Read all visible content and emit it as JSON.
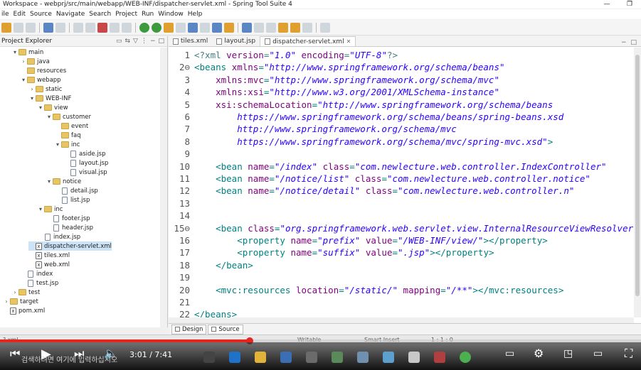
{
  "window": {
    "title": "Workspace - webprj/src/main/webapp/WEB-INF/dispatcher-servlet.xml - Spring Tool Suite 4",
    "controls": [
      "—",
      "❐"
    ]
  },
  "menu": [
    "ile",
    "Edit",
    "Source",
    "Navigate",
    "Search",
    "Project",
    "Run",
    "Window",
    "Help"
  ],
  "explorer": {
    "title": "Project Explorer",
    "tree": [
      {
        "label": "main",
        "indent": 1,
        "icon": "folder",
        "arrow": "▾"
      },
      {
        "label": "java",
        "indent": 2,
        "icon": "folder",
        "arrow": "›"
      },
      {
        "label": "resources",
        "indent": 2,
        "icon": "folder",
        "arrow": ""
      },
      {
        "label": "webapp",
        "indent": 2,
        "icon": "folder",
        "arrow": "▾"
      },
      {
        "label": "static",
        "indent": 3,
        "icon": "folder",
        "arrow": "›"
      },
      {
        "label": "WEB-INF",
        "indent": 3,
        "icon": "folder",
        "arrow": "▾"
      },
      {
        "label": "view",
        "indent": 4,
        "icon": "folder",
        "arrow": "▾"
      },
      {
        "label": "customer",
        "indent": 5,
        "icon": "folder",
        "arrow": "▾"
      },
      {
        "label": "event",
        "indent": 6,
        "icon": "folder",
        "arrow": ""
      },
      {
        "label": "faq",
        "indent": 6,
        "icon": "folder",
        "arrow": ""
      },
      {
        "label": "inc",
        "indent": 6,
        "icon": "folder",
        "arrow": "▾"
      },
      {
        "label": "aside.jsp",
        "indent": 7,
        "icon": "file",
        "arrow": ""
      },
      {
        "label": "layout.jsp",
        "indent": 7,
        "icon": "file",
        "arrow": ""
      },
      {
        "label": "visual.jsp",
        "indent": 7,
        "icon": "file",
        "arrow": ""
      },
      {
        "label": "notice",
        "indent": 5,
        "icon": "folder",
        "arrow": "▾"
      },
      {
        "label": "detail.jsp",
        "indent": 6,
        "icon": "file",
        "arrow": ""
      },
      {
        "label": "list.jsp",
        "indent": 6,
        "icon": "file",
        "arrow": ""
      },
      {
        "label": "inc",
        "indent": 4,
        "icon": "folder",
        "arrow": "▾"
      },
      {
        "label": "footer.jsp",
        "indent": 5,
        "icon": "file",
        "arrow": ""
      },
      {
        "label": "header.jsp",
        "indent": 5,
        "icon": "file",
        "arrow": ""
      },
      {
        "label": "index.jsp",
        "indent": 4,
        "icon": "file",
        "arrow": ""
      },
      {
        "label": "dispatcher-servlet.xml",
        "indent": 3,
        "icon": "xml",
        "arrow": "",
        "selected": true
      },
      {
        "label": "tiles.xml",
        "indent": 3,
        "icon": "xml",
        "arrow": ""
      },
      {
        "label": "web.xml",
        "indent": 3,
        "icon": "xml",
        "arrow": ""
      },
      {
        "label": "index",
        "indent": 2,
        "icon": "file",
        "arrow": ""
      },
      {
        "label": "test.jsp",
        "indent": 2,
        "icon": "file",
        "arrow": ""
      },
      {
        "label": "test",
        "indent": 1,
        "icon": "folder",
        "arrow": "›"
      },
      {
        "label": "target",
        "indent": 0,
        "icon": "folder",
        "arrow": "›"
      },
      {
        "label": "pom.xml",
        "indent": 0,
        "icon": "xml",
        "arrow": ""
      }
    ]
  },
  "editor": {
    "tabs": [
      {
        "label": "tiles.xml",
        "active": false
      },
      {
        "label": "layout.jsp",
        "active": false
      },
      {
        "label": "dispatcher-servlet.xml",
        "active": true
      }
    ],
    "lines": [
      {
        "n": "1",
        "tokens": [
          [
            "pi",
            "<?xml "
          ],
          [
            "a",
            "version"
          ],
          [
            "pi",
            "="
          ],
          [
            "v",
            "\"1.0\""
          ],
          [
            "pi",
            " "
          ],
          [
            "a",
            "encoding"
          ],
          [
            "pi",
            "="
          ],
          [
            "v",
            "\"UTF-8\""
          ],
          [
            "pi",
            "?>"
          ]
        ]
      },
      {
        "n": "2⊖",
        "tokens": [
          [
            "p",
            "<beans "
          ],
          [
            "a",
            "xmlns"
          ],
          [
            "p",
            "="
          ],
          [
            "v",
            "\"http://www.springframework.org/schema/beans\""
          ]
        ]
      },
      {
        "n": "3",
        "tokens": [
          [
            "p",
            "    "
          ],
          [
            "a",
            "xmlns:mvc"
          ],
          [
            "p",
            "="
          ],
          [
            "v",
            "\"http://www.springframework.org/schema/mvc\""
          ]
        ]
      },
      {
        "n": "4",
        "tokens": [
          [
            "p",
            "    "
          ],
          [
            "a",
            "xmlns:xsi"
          ],
          [
            "p",
            "="
          ],
          [
            "v",
            "\"http://www.w3.org/2001/XMLSchema-instance\""
          ]
        ]
      },
      {
        "n": "5",
        "tokens": [
          [
            "p",
            "    "
          ],
          [
            "a",
            "xsi:schemaLocation"
          ],
          [
            "p",
            "="
          ],
          [
            "v",
            "\"http://www.springframework.org/schema/beans"
          ]
        ]
      },
      {
        "n": "6",
        "tokens": [
          [
            "v",
            "        https://www.springframework.org/schema/beans/spring-beans.xsd"
          ]
        ]
      },
      {
        "n": "7",
        "tokens": [
          [
            "v",
            "        http://www.springframework.org/schema/mvc"
          ]
        ]
      },
      {
        "n": "8",
        "tokens": [
          [
            "v",
            "        https://www.springframework.org/schema/mvc/spring-mvc.xsd\""
          ],
          [
            "p",
            ">"
          ]
        ]
      },
      {
        "n": "9",
        "tokens": [
          [
            "p",
            ""
          ]
        ]
      },
      {
        "n": "10",
        "tokens": [
          [
            "p",
            "    <bean "
          ],
          [
            "a",
            "name"
          ],
          [
            "p",
            "="
          ],
          [
            "v",
            "\"/index\""
          ],
          [
            "p",
            " "
          ],
          [
            "a",
            "class"
          ],
          [
            "p",
            "="
          ],
          [
            "v",
            "\"com.newlecture.web.controller.IndexController\""
          ]
        ]
      },
      {
        "n": "11",
        "tokens": [
          [
            "p",
            "    <bean "
          ],
          [
            "a",
            "name"
          ],
          [
            "p",
            "="
          ],
          [
            "v",
            "\"/notice/list\""
          ],
          [
            "p",
            " "
          ],
          [
            "a",
            "class"
          ],
          [
            "p",
            "="
          ],
          [
            "v",
            "\"com.newlecture.web.controller.notice\""
          ]
        ]
      },
      {
        "n": "12",
        "tokens": [
          [
            "p",
            "    <bean "
          ],
          [
            "a",
            "name"
          ],
          [
            "p",
            "="
          ],
          [
            "v",
            "\"/notice/detail\""
          ],
          [
            "p",
            " "
          ],
          [
            "a",
            "class"
          ],
          [
            "p",
            "="
          ],
          [
            "v",
            "\"com.newlecture.web.controller.n\""
          ]
        ]
      },
      {
        "n": "13",
        "tokens": [
          [
            "p",
            ""
          ]
        ]
      },
      {
        "n": "14",
        "tokens": [
          [
            "p",
            ""
          ]
        ]
      },
      {
        "n": "15⊖",
        "tokens": [
          [
            "p",
            "    <bean "
          ],
          [
            "a",
            "class"
          ],
          [
            "p",
            "="
          ],
          [
            "v",
            "\"org.springframework.web.servlet.view.InternalResourceViewResolver\""
          ]
        ]
      },
      {
        "n": "16",
        "tokens": [
          [
            "p",
            "        <property "
          ],
          [
            "a",
            "name"
          ],
          [
            "p",
            "="
          ],
          [
            "v",
            "\"prefix\""
          ],
          [
            "p",
            " "
          ],
          [
            "a",
            "value"
          ],
          [
            "p",
            "="
          ],
          [
            "v",
            "\"/WEB-INF/view/\""
          ],
          [
            "p",
            "></property>"
          ]
        ]
      },
      {
        "n": "17",
        "tokens": [
          [
            "p",
            "        <property "
          ],
          [
            "a",
            "name"
          ],
          [
            "p",
            "="
          ],
          [
            "v",
            "\"suffix\""
          ],
          [
            "p",
            " "
          ],
          [
            "a",
            "value"
          ],
          [
            "p",
            "="
          ],
          [
            "v",
            "\".jsp\""
          ],
          [
            "p",
            "></property>"
          ]
        ]
      },
      {
        "n": "18",
        "tokens": [
          [
            "p",
            "    </bean>"
          ]
        ]
      },
      {
        "n": "19",
        "tokens": [
          [
            "p",
            ""
          ]
        ]
      },
      {
        "n": "20",
        "tokens": [
          [
            "p",
            "    <mvc:resources "
          ],
          [
            "a",
            "location"
          ],
          [
            "p",
            "="
          ],
          [
            "v",
            "\"/static/\""
          ],
          [
            "p",
            " "
          ],
          [
            "a",
            "mapping"
          ],
          [
            "p",
            "="
          ],
          [
            "v",
            "\"/**\""
          ],
          [
            "p",
            "></mvc:resources>"
          ]
        ]
      },
      {
        "n": "21",
        "tokens": [
          [
            "p",
            ""
          ]
        ]
      },
      {
        "n": "22",
        "tokens": [
          [
            "p",
            "</beans>"
          ]
        ]
      }
    ],
    "bottom_tabs": [
      "Design",
      "Source"
    ]
  },
  "status": {
    "left": "?.xml",
    "writable": "Writable",
    "insert": "Smart Insert",
    "position": "1 : 1 : 0"
  },
  "player": {
    "time": "3:01 / 7:41",
    "subtitle": "검색하려면 여기에 입력하십시오",
    "progress": 0.39
  }
}
